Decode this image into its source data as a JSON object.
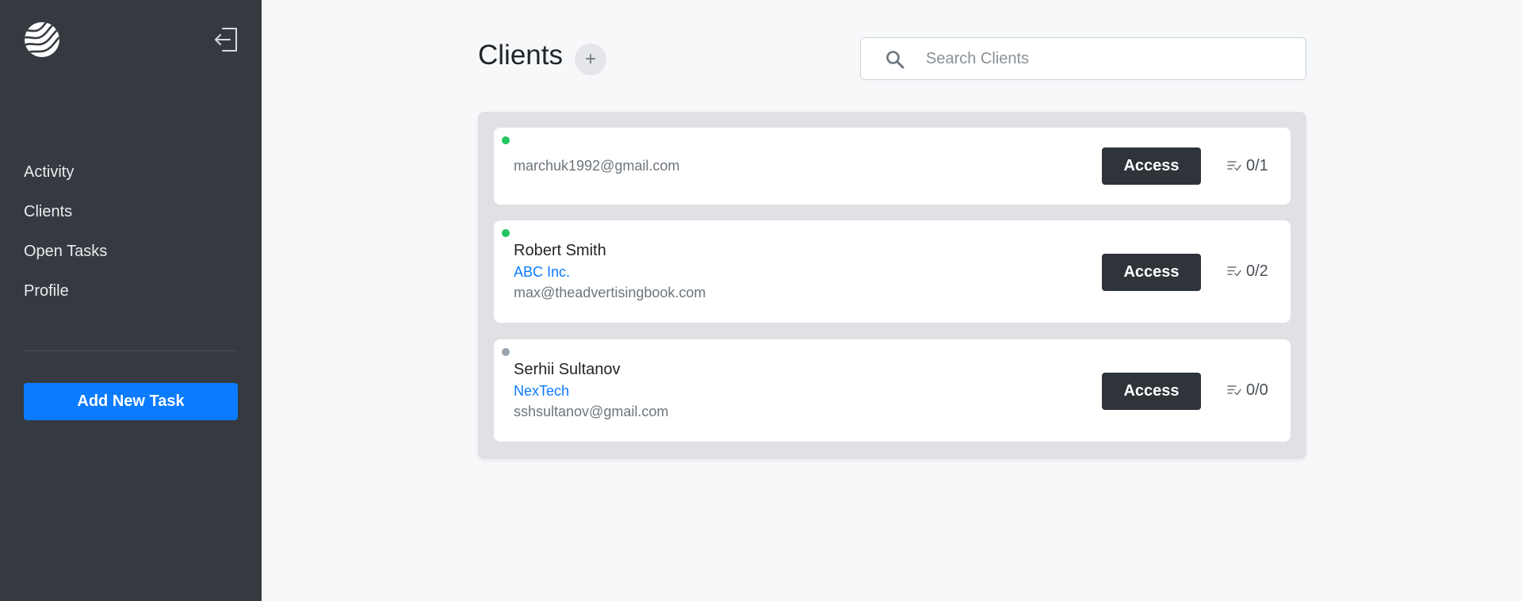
{
  "sidebar": {
    "logo_icon": "wave-logo-icon",
    "logout_icon": "logout-icon",
    "nav": [
      {
        "label": "Activity"
      },
      {
        "label": "Clients"
      },
      {
        "label": "Open Tasks"
      },
      {
        "label": "Profile"
      }
    ],
    "add_task_label": "Add New Task",
    "add_task_color": "#0b7bff",
    "background": "#343a40"
  },
  "header": {
    "title": "Clients",
    "add_client_symbol": "+"
  },
  "search": {
    "placeholder": "Search Clients",
    "value": ""
  },
  "clients": [
    {
      "status": "online",
      "status_color": "#22c55e",
      "name": "",
      "company": "",
      "email": "marchuk1992@gmail.com",
      "access_label": "Access",
      "tasks": "0/1"
    },
    {
      "status": "online",
      "status_color": "#22c55e",
      "name": "Robert Smith",
      "company": "ABC Inc.",
      "email": "max@theadvertisingbook.com",
      "access_label": "Access",
      "tasks": "0/2"
    },
    {
      "status": "offline",
      "status_color": "#9ca3af",
      "name": "Serhii Sultanov",
      "company": "NexTech",
      "email": "sshsultanov@gmail.com",
      "access_label": "Access",
      "tasks": "0/0"
    }
  ]
}
